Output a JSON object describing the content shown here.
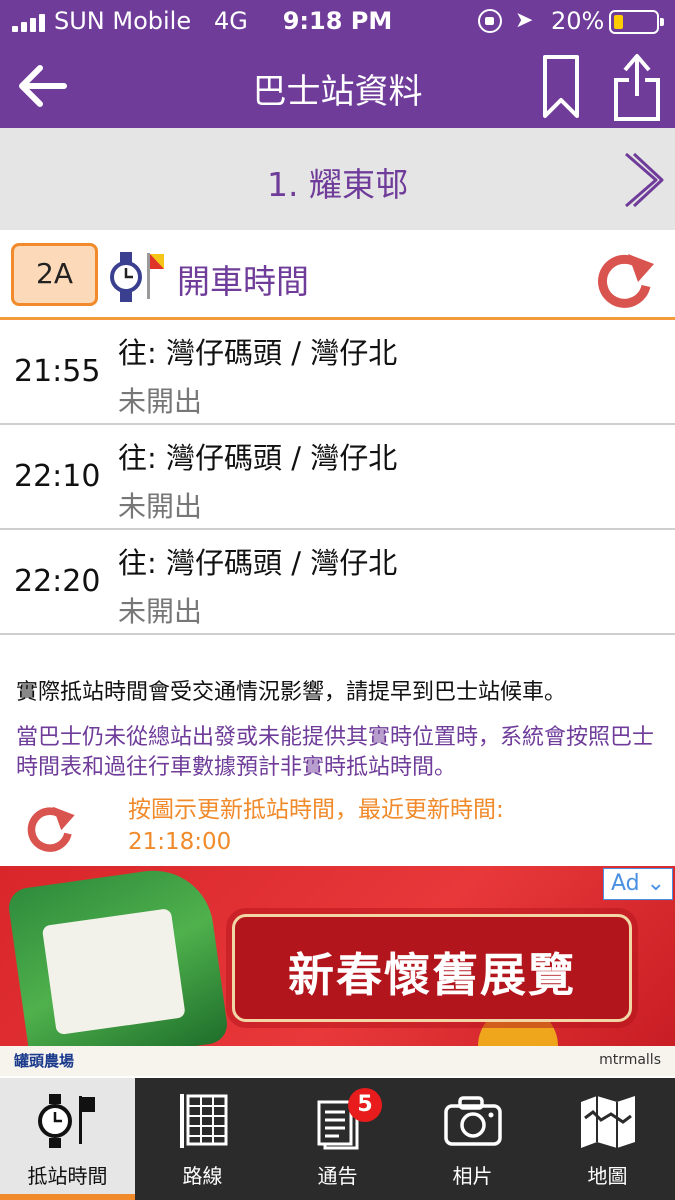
{
  "status_bar": {
    "carrier": "SUN Mobile",
    "network": "4G",
    "time": "9:18 PM",
    "battery": "20%",
    "battery_level": 0.2
  },
  "nav": {
    "title": "巴士站資料"
  },
  "stop": {
    "name": "1. 耀東邨"
  },
  "route": {
    "number": "2A",
    "section_title": "開車時間"
  },
  "departures": [
    {
      "time": "21:55",
      "destination": "往: 灣仔碼頭 / 灣仔北",
      "status": "未開出"
    },
    {
      "time": "22:10",
      "destination": "往: 灣仔碼頭 / 灣仔北",
      "status": "未開出"
    },
    {
      "time": "22:20",
      "destination": "往: 灣仔碼頭 / 灣仔北",
      "status": "未開出"
    }
  ],
  "notes": {
    "traffic": "實際抵站時間會受交通情況影響，請提早到巴士站候車。",
    "estimate": "當巴士仍未從總站出發或未能提供其實時位置時，系統會按照巴士時間表和過往行車數據預計非實時抵站時間。",
    "update_label": "按圖示更新抵站時間，最近更新時間:",
    "update_time": "21:18:00"
  },
  "ad": {
    "badge": "Ad",
    "headline": "新春懷舊展覽",
    "footer_left": "罐頭農場",
    "footer_right": "mtrmalls"
  },
  "tabs": [
    {
      "label": "抵站時間",
      "icon": "clock-flag-icon",
      "active": true
    },
    {
      "label": "路線",
      "icon": "route-list-icon",
      "active": false
    },
    {
      "label": "通告",
      "icon": "notice-icon",
      "active": false,
      "badge": "5"
    },
    {
      "label": "相片",
      "icon": "camera-icon",
      "active": false
    },
    {
      "label": "地圖",
      "icon": "map-icon",
      "active": false
    }
  ],
  "colors": {
    "primary": "#6f3c9a",
    "accent": "#f08a2a",
    "refresh": "#d9534f"
  }
}
